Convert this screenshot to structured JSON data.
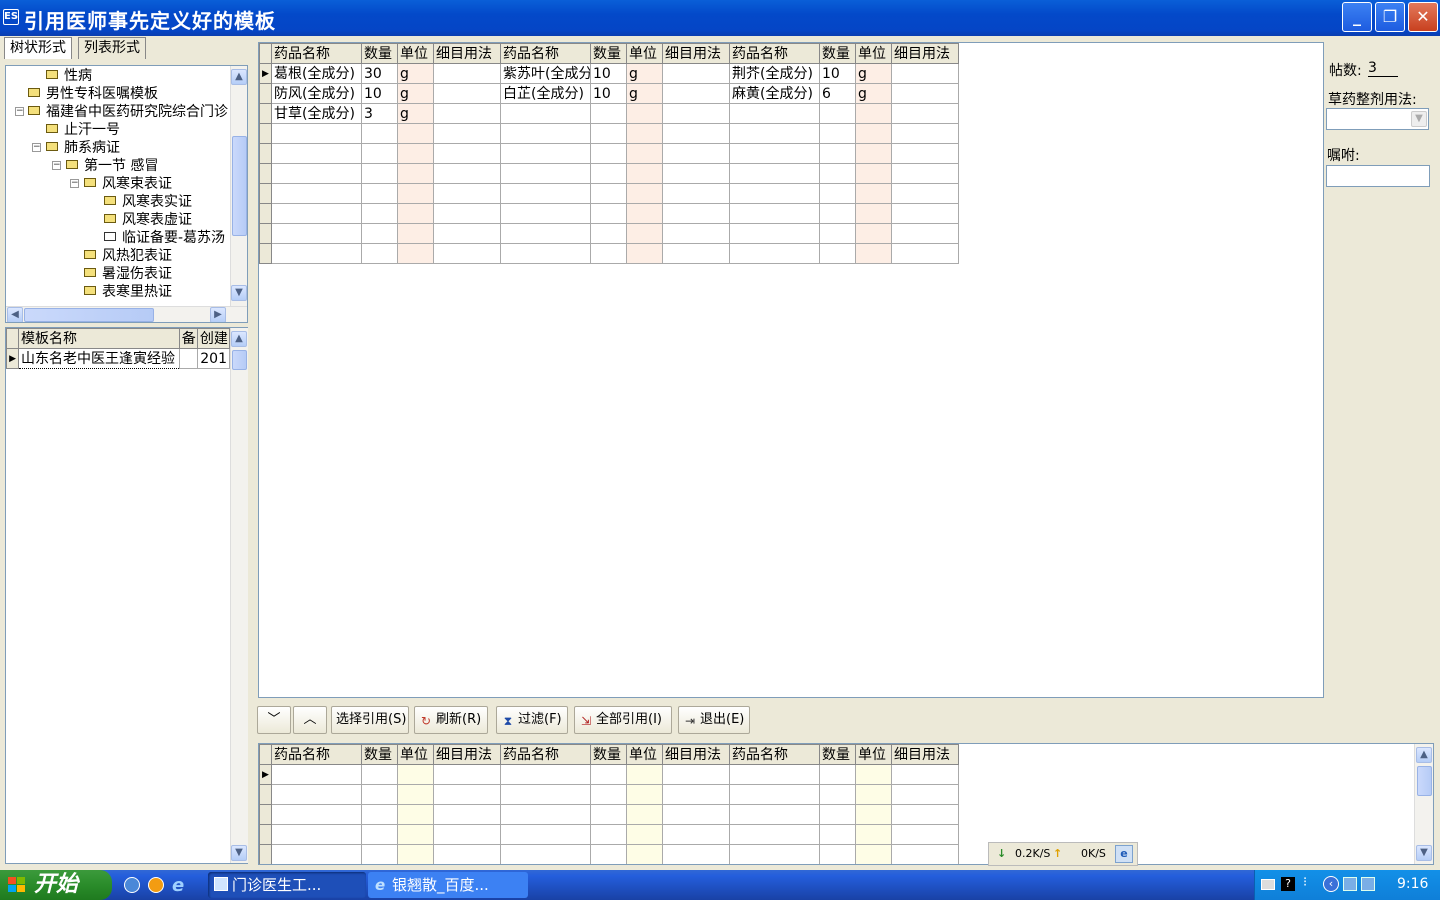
{
  "window": {
    "title": "引用医师事先定义好的模板",
    "app_icon": "app-icon"
  },
  "tabs": [
    {
      "label": "树状形式"
    },
    {
      "label": "列表形式"
    }
  ],
  "tree": [
    {
      "label": "性病",
      "level": 2
    },
    {
      "label": "男性专科医嘱模板",
      "level": 1
    },
    {
      "label": "福建省中医药研究院综合门诊",
      "level": 1
    },
    {
      "label": "止汗一号",
      "level": 2
    },
    {
      "label": "肺系病证",
      "level": 2
    },
    {
      "label": "第一节  感冒",
      "level": 3
    },
    {
      "label": "风寒束表证",
      "level": 4
    },
    {
      "label": "风寒表实证",
      "level": 5
    },
    {
      "label": "风寒表虚证",
      "level": 5
    },
    {
      "label": "临证备要-葛苏汤",
      "level": 5
    },
    {
      "label": "风热犯表证",
      "level": 4
    },
    {
      "label": "暑湿伤表证",
      "level": 4
    },
    {
      "label": "表寒里热证",
      "level": 4
    }
  ],
  "template_list": {
    "headers": [
      "模板名称",
      "备",
      "创建"
    ],
    "rows": [
      [
        "山东名老中医王逢寅经验",
        "",
        "201"
      ]
    ]
  },
  "herb_headers": [
    "药品名称",
    "数量",
    "单位",
    "细目用法",
    "药品名称",
    "数量",
    "单位",
    "细目用法",
    "药品名称",
    "数量",
    "单位",
    "细目用法"
  ],
  "herb_rows": [
    [
      "葛根(全成分)",
      "30",
      "g",
      "",
      "紫苏叶(全成分)",
      "10",
      "g",
      "",
      "荆芥(全成分)",
      "10",
      "g",
      ""
    ],
    [
      "防风(全成分)",
      "10",
      "g",
      "",
      "白芷(全成分)",
      "10",
      "g",
      "",
      "麻黄(全成分)",
      "6",
      "g",
      ""
    ],
    [
      "甘草(全成分)",
      "3",
      "g",
      "",
      "",
      "",
      "",
      "",
      "",
      "",
      "",
      ""
    ]
  ],
  "right_panel": {
    "dose_label": "帖数:",
    "dose_value": "3",
    "usage_label": "草药整剂用法:",
    "usage_value": "",
    "instruction_label": "嘱咐:",
    "instruction_value": ""
  },
  "toolbar": {
    "down": "﹀",
    "up": "︿",
    "select_ref": "选择引用(S)",
    "refresh": "刷新(R)",
    "filter": "过滤(F)",
    "ref_all": "全部引用(I)",
    "exit": "退出(E)"
  },
  "netspeed": {
    "down": "0.2K/S",
    "up": "0K/S"
  },
  "taskbar": {
    "start": "开始",
    "tasks": [
      "门诊医生工...",
      "银翘散_百度..."
    ],
    "clock": "9:16"
  },
  "colors": {
    "titlebar": "#0349c9",
    "unit_column": "#fdeee5",
    "unit_column_bottom": "#fefde6",
    "taskbar": "#245edc",
    "start": "#2a8c2a"
  }
}
